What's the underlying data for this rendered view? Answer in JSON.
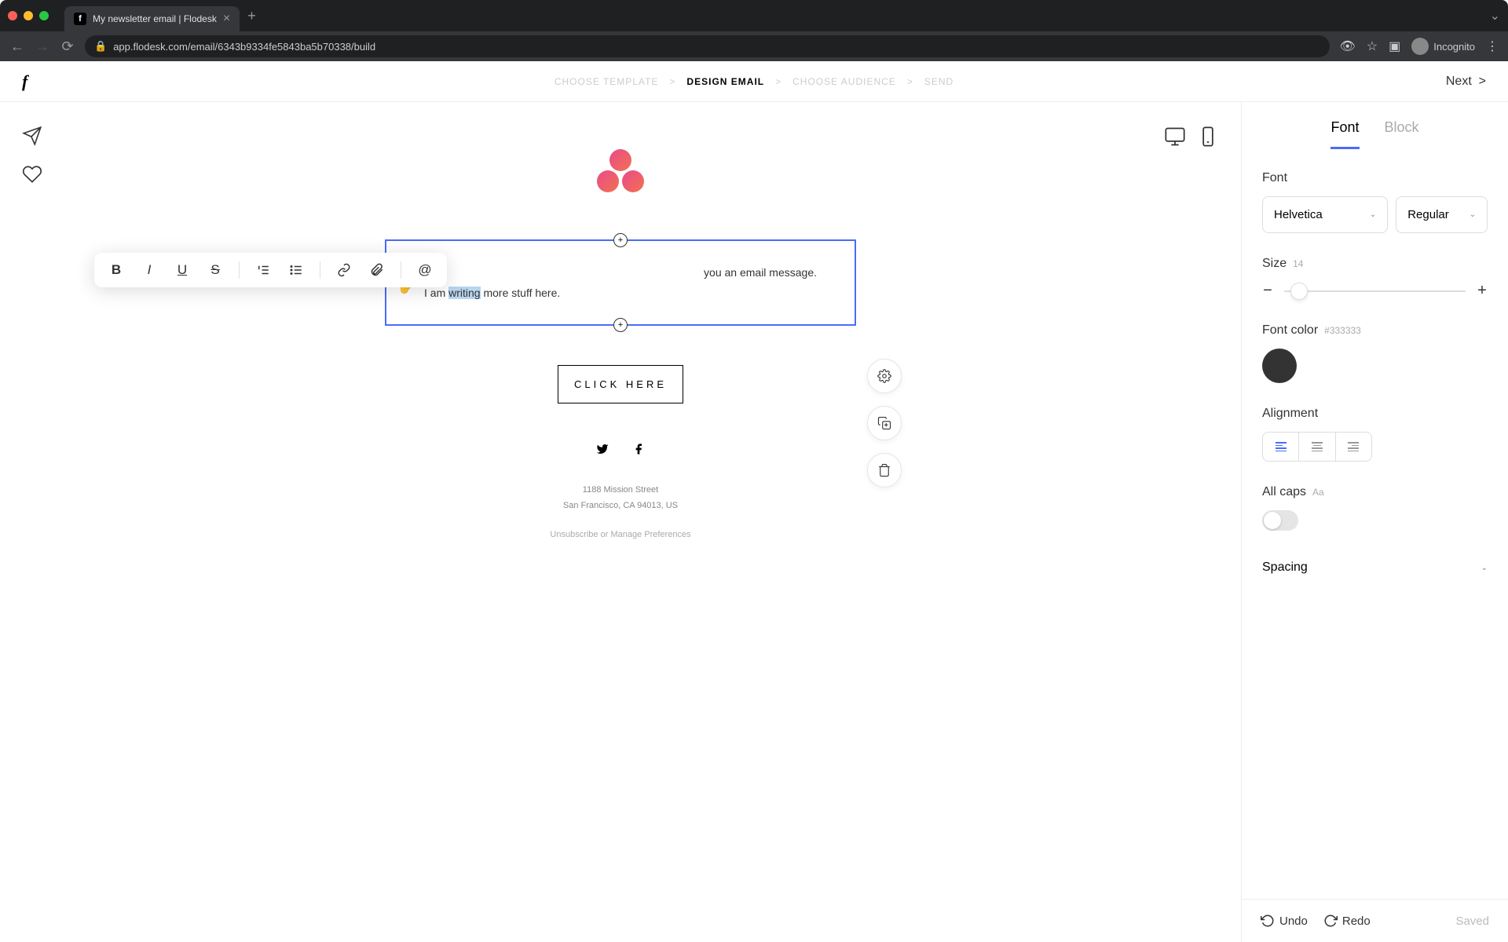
{
  "browser": {
    "tab_title": "My newsletter email | Flodesk",
    "url": "app.flodesk.com/email/6343b9334fe5843ba5b70338/build",
    "incognito_label": "Incognito"
  },
  "header": {
    "logo": "f",
    "breadcrumbs": [
      "CHOOSE TEMPLATE",
      "DESIGN EMAIL",
      "CHOOSE AUDIENCE",
      "SEND"
    ],
    "active_step": "DESIGN EMAIL",
    "next_label": "Next"
  },
  "email": {
    "line1_suffix": "you an email message.",
    "line2_prefix": "I am ",
    "line2_highlight": "writing",
    "line2_suffix": " more stuff here.",
    "cta": "CLICK HERE",
    "address1": "1188 Mission Street",
    "address2": "San Francisco, CA 94013, US",
    "unsubscribe": "Unsubscribe",
    "or": " or ",
    "manage": "Manage Preferences"
  },
  "sidebar": {
    "tabs": {
      "font": "Font",
      "block": "Block"
    },
    "font_label": "Font",
    "font_value": "Helvetica",
    "weight_value": "Regular",
    "size_label": "Size",
    "size_value": "14",
    "color_label": "Font color",
    "color_value": "#333333",
    "alignment_label": "Alignment",
    "allcaps_label": "All caps",
    "allcaps_hint": "Aa",
    "spacing_label": "Spacing"
  },
  "footer": {
    "undo": "Undo",
    "redo": "Redo",
    "saved": "Saved"
  }
}
